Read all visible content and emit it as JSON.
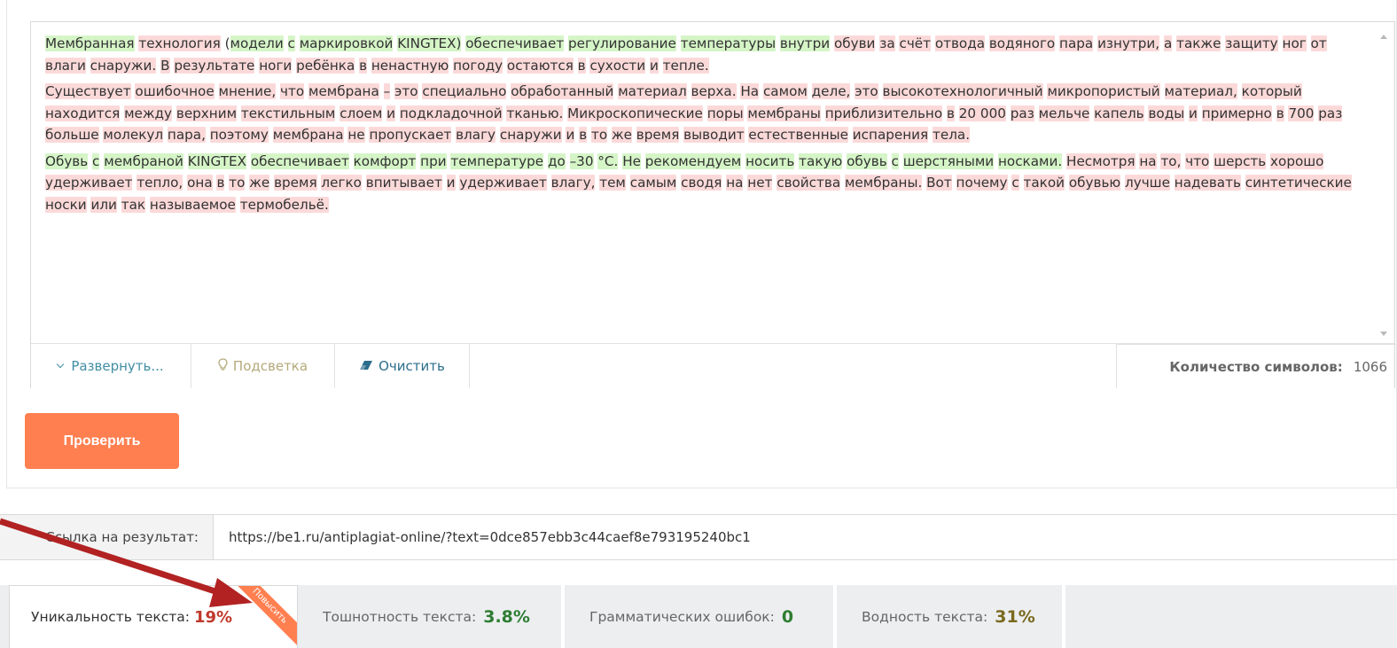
{
  "editor": {
    "paragraphs": [
      [
        [
          "Мембранная",
          "g"
        ],
        " ",
        [
          "технология",
          "r"
        ],
        " (",
        [
          "модели",
          "g"
        ],
        " ",
        [
          "с",
          "g"
        ],
        " ",
        [
          "маркировкой",
          "g"
        ],
        " ",
        [
          "KINGTEX)",
          "g"
        ],
        " ",
        [
          "обеспечивает",
          "g"
        ],
        " ",
        [
          "регулирование",
          "g"
        ],
        " ",
        [
          "температуры",
          "g"
        ],
        " ",
        [
          "внутри",
          "g"
        ],
        " ",
        [
          "обуви",
          "r"
        ],
        " ",
        [
          "за",
          "r"
        ],
        " ",
        [
          "счёт",
          "r"
        ],
        " ",
        [
          "отвода",
          "r"
        ],
        " ",
        [
          "водяного",
          "r"
        ],
        " ",
        [
          "пара",
          "r"
        ],
        " ",
        [
          "изнутри,",
          "r"
        ],
        " ",
        [
          "а",
          "r"
        ],
        " ",
        [
          "также",
          "r"
        ],
        " ",
        [
          "защиту",
          "r"
        ],
        " ",
        [
          "ног",
          "r"
        ],
        " ",
        [
          "от",
          "r"
        ],
        " ",
        [
          "влаги",
          "r"
        ],
        " ",
        [
          "снаружи.",
          "r"
        ],
        " ",
        [
          "В",
          "r"
        ],
        " ",
        [
          "результате",
          "r"
        ],
        " ",
        [
          "ноги",
          "r"
        ],
        " ",
        [
          "ребёнка",
          "r"
        ],
        " ",
        [
          "в",
          "r"
        ],
        " ",
        [
          "ненастную",
          "r"
        ],
        " ",
        [
          "погоду",
          "r"
        ],
        " ",
        [
          "остаются",
          "r"
        ],
        " ",
        [
          "в",
          "r"
        ],
        " ",
        [
          "сухости",
          "r"
        ],
        " ",
        [
          "и",
          "r"
        ],
        " ",
        [
          "тепле.",
          "r"
        ]
      ],
      [
        [
          "Существует",
          "r"
        ],
        " ",
        [
          "ошибочное",
          "r"
        ],
        " ",
        [
          "мнение,",
          "r"
        ],
        " ",
        [
          "что",
          "r"
        ],
        " ",
        [
          "мембрана",
          "r"
        ],
        " ",
        [
          "–",
          "r"
        ],
        " ",
        [
          "это",
          "r"
        ],
        " ",
        [
          "специально",
          "r"
        ],
        " ",
        [
          "обработанный",
          "r"
        ],
        " ",
        [
          "материал",
          "r"
        ],
        " ",
        [
          "верха.",
          "r"
        ],
        " ",
        [
          "На",
          "r"
        ],
        " ",
        [
          "самом",
          "r"
        ],
        " ",
        [
          "деле,",
          "r"
        ],
        " ",
        [
          "это",
          "r"
        ],
        " ",
        [
          "высокотехнологичный",
          "r"
        ],
        " ",
        [
          "микропористый",
          "r"
        ],
        " ",
        [
          "материал,",
          "r"
        ],
        " ",
        [
          "который",
          "r"
        ],
        " ",
        [
          "находится",
          "r"
        ],
        " ",
        [
          "между",
          "r"
        ],
        " ",
        [
          "верхним",
          "r"
        ],
        " ",
        [
          "текстильным",
          "r"
        ],
        " ",
        [
          "слоем",
          "r"
        ],
        " ",
        [
          "и",
          "r"
        ],
        " ",
        [
          "подкладочной",
          "r"
        ],
        " ",
        [
          "тканью.",
          "r"
        ],
        " ",
        [
          "Микроскопические",
          "r"
        ],
        " ",
        [
          "поры",
          "r"
        ],
        " ",
        [
          "мембраны",
          "r"
        ],
        " ",
        [
          "приблизительно",
          "r"
        ],
        " ",
        [
          "в",
          "r"
        ],
        " ",
        [
          "20 000",
          "r"
        ],
        " ",
        [
          "раз",
          "r"
        ],
        " ",
        [
          "мельче",
          "r"
        ],
        " ",
        [
          "капель",
          "r"
        ],
        " ",
        [
          "воды",
          "r"
        ],
        " ",
        [
          "и",
          "r"
        ],
        " ",
        [
          "примерно",
          "r"
        ],
        " ",
        [
          "в",
          "r"
        ],
        " ",
        [
          "700",
          "r"
        ],
        " ",
        [
          "раз",
          "r"
        ],
        " ",
        [
          "больше",
          "r"
        ],
        " ",
        [
          "молекул",
          "r"
        ],
        " ",
        [
          "пара,",
          "r"
        ],
        " ",
        [
          "поэтому",
          "r"
        ],
        " ",
        [
          "мембрана",
          "r"
        ],
        " ",
        [
          "не",
          "r"
        ],
        " ",
        [
          "пропускает",
          "r"
        ],
        " ",
        [
          "влагу",
          "r"
        ],
        " ",
        [
          "снаружи",
          "r"
        ],
        " ",
        [
          "и",
          "r"
        ],
        " ",
        [
          "в",
          "r"
        ],
        " ",
        [
          "то",
          "r"
        ],
        " ",
        [
          "же",
          "r"
        ],
        " ",
        [
          "время",
          "r"
        ],
        " ",
        [
          "выводит",
          "r"
        ],
        " ",
        [
          "естественные",
          "r"
        ],
        " ",
        [
          "испарения",
          "r"
        ],
        " ",
        [
          "тела.",
          "r"
        ]
      ],
      [
        [
          "Обувь",
          "g"
        ],
        " ",
        [
          "с",
          "g"
        ],
        " ",
        [
          "мембраной",
          "g"
        ],
        " ",
        [
          "KINGTEX",
          "g"
        ],
        " ",
        [
          "обеспечивает",
          "g"
        ],
        " ",
        [
          "комфорт",
          "g"
        ],
        " ",
        [
          "при",
          "g"
        ],
        " ",
        [
          "температуре",
          "g"
        ],
        " ",
        [
          "до",
          "g"
        ],
        " ",
        [
          "–30",
          "g"
        ],
        " ",
        [
          "°С.",
          "g"
        ],
        " ",
        [
          "Не",
          "g"
        ],
        " ",
        [
          "рекомендуем",
          "g"
        ],
        " ",
        [
          "носить",
          "g"
        ],
        " ",
        [
          "такую",
          "g"
        ],
        " ",
        [
          "обувь",
          "g"
        ],
        " ",
        [
          "с",
          "g"
        ],
        " ",
        [
          "шерстяными",
          "g"
        ],
        " ",
        [
          "носками.",
          "g"
        ],
        " ",
        [
          "Несмотря",
          "r"
        ],
        " ",
        [
          "на",
          "r"
        ],
        " ",
        [
          "то,",
          "r"
        ],
        " ",
        [
          "что",
          "r"
        ],
        " ",
        [
          "шерсть",
          "r"
        ],
        " ",
        [
          "хорошо",
          "r"
        ],
        " ",
        [
          "удерживает",
          "r"
        ],
        " ",
        [
          "тепло,",
          "r"
        ],
        " ",
        [
          "она",
          "r"
        ],
        " ",
        [
          "в",
          "r"
        ],
        " ",
        [
          "то",
          "r"
        ],
        " ",
        [
          "же",
          "r"
        ],
        " ",
        [
          "время",
          "r"
        ],
        " ",
        [
          "легко",
          "r"
        ],
        " ",
        [
          "впитывает",
          "r"
        ],
        " ",
        [
          "и",
          "r"
        ],
        " ",
        [
          "удерживает",
          "r"
        ],
        " ",
        [
          "влагу,",
          "r"
        ],
        " ",
        [
          "тем",
          "r"
        ],
        " ",
        [
          "самым",
          "r"
        ],
        " ",
        [
          "сводя",
          "r"
        ],
        " ",
        [
          "на",
          "r"
        ],
        " ",
        [
          "нет",
          "r"
        ],
        " ",
        [
          "свойства",
          "r"
        ],
        " ",
        [
          "мембраны.",
          "r"
        ],
        " ",
        [
          "Вот",
          "r"
        ],
        " ",
        [
          "почему",
          "r"
        ],
        " ",
        [
          "с",
          "r"
        ],
        " ",
        [
          "такой",
          "r"
        ],
        " ",
        [
          "обувью",
          "r"
        ],
        " ",
        [
          "лучше",
          "r"
        ],
        " ",
        [
          "надевать",
          "r"
        ],
        " ",
        [
          "синтетические",
          "r"
        ],
        " ",
        [
          "носки",
          "r"
        ],
        " ",
        [
          "или",
          "r"
        ],
        " ",
        [
          "так",
          "r"
        ],
        " ",
        [
          "называемое",
          "r"
        ],
        " ",
        [
          "термобельё.",
          "r"
        ]
      ]
    ]
  },
  "toolbar": {
    "expand_label": "Развернуть...",
    "highlight_label": "Подсветка",
    "clear_label": "Очистить",
    "char_count_label": "Количество символов:",
    "char_count_value": "1066"
  },
  "check_button": "Проверить",
  "result_link": {
    "label": "Ссылка на результат:",
    "url": "https://be1.ru/antiplagiat-online/?text=0dce857ebb3c44caef8e793195240bc1"
  },
  "tabs": [
    {
      "label": "Уникальность текста:",
      "value": "19%",
      "value_color": "#c0392b",
      "ribbon": "Повысить"
    },
    {
      "label": "Тошнотность текста:",
      "value": "3.8%",
      "value_color": "#2e7d32"
    },
    {
      "label": "Грамматических ошибок:",
      "value": "0",
      "value_color": "#2e7d32"
    },
    {
      "label": "Водность текста:",
      "value": "31%",
      "value_color": "#7a6a1f"
    }
  ],
  "colors": {
    "highlight_green": "#d5f5c7",
    "highlight_red": "#fbd9d9",
    "accent_orange": "#ff7f50",
    "annotation_arrow": "#b22222"
  }
}
